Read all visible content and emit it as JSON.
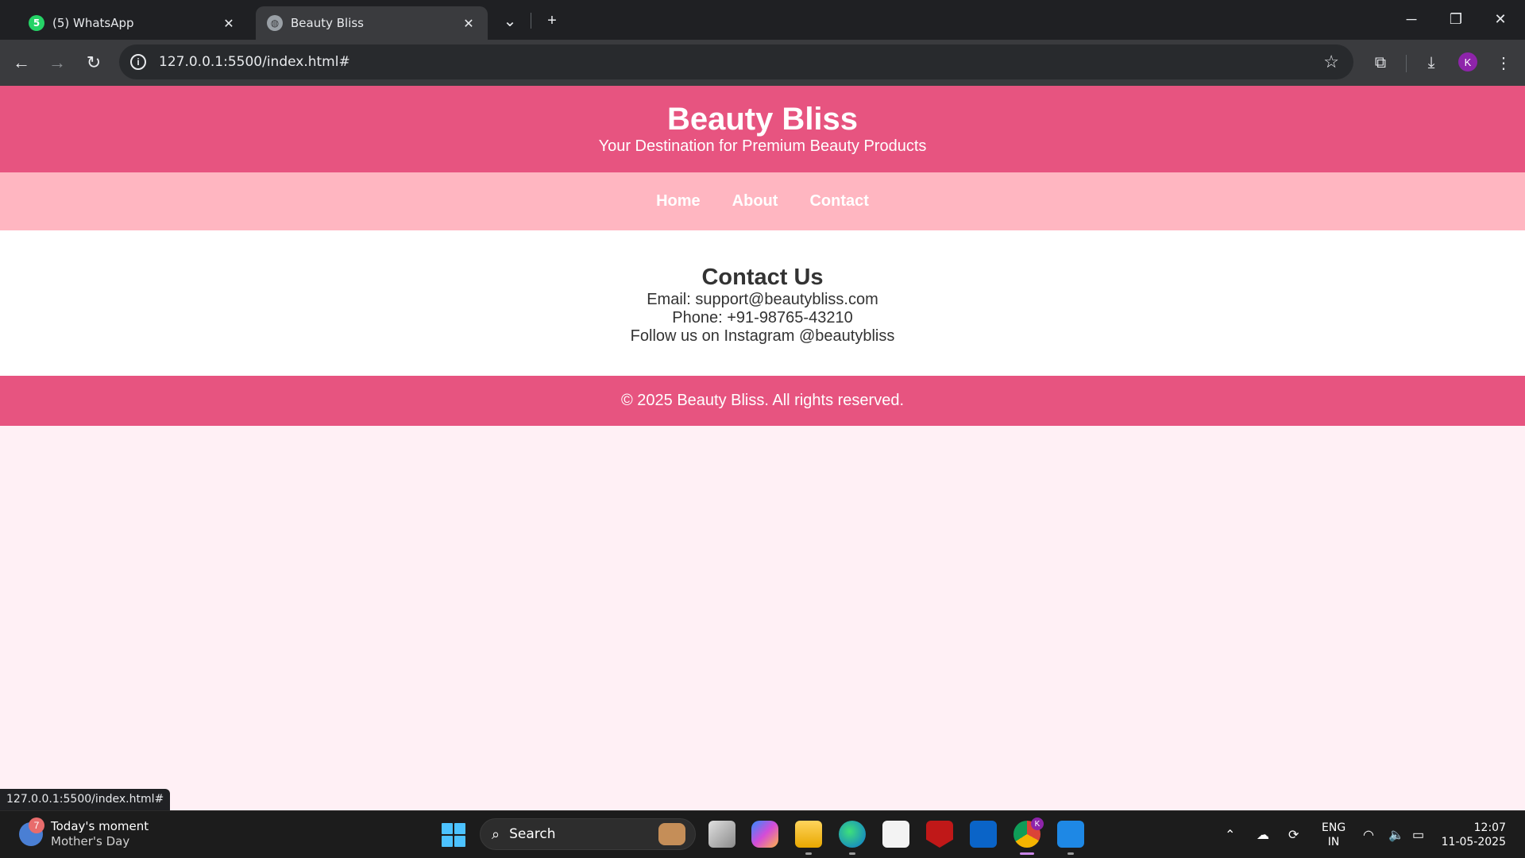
{
  "browser": {
    "tabs": [
      {
        "title": "(5) WhatsApp",
        "badge": "5",
        "icon": "whatsapp-icon"
      },
      {
        "title": "Beauty Bliss",
        "icon": "globe-icon"
      }
    ],
    "address": "127.0.0.1:5500/index.html#",
    "profile_initial": "K",
    "status_url": "127.0.0.1:5500/index.html#"
  },
  "site": {
    "title": "Beauty Bliss",
    "tagline": "Your Destination for Premium Beauty Products",
    "nav": [
      "Home",
      "About",
      "Contact"
    ],
    "contact": {
      "heading": "Contact Us",
      "email": "Email: support@beautybliss.com",
      "phone": "Phone: +91-98765-43210",
      "instagram": "Follow us on Instagram @beautybliss"
    },
    "footer": "© 2025 Beauty Bliss. All rights reserved.",
    "colors": {
      "primary": "#e75480",
      "nav": "#ffb6c1",
      "background": "#fff0f5"
    }
  },
  "taskbar": {
    "widget": {
      "badge": "7",
      "title": "Today's moment",
      "subtitle": "Mother's Day"
    },
    "search_label": "Search",
    "profile_badge": "K",
    "language": {
      "line1": "ENG",
      "line2": "IN"
    },
    "time": "12:07",
    "date": "11-05-2025"
  }
}
